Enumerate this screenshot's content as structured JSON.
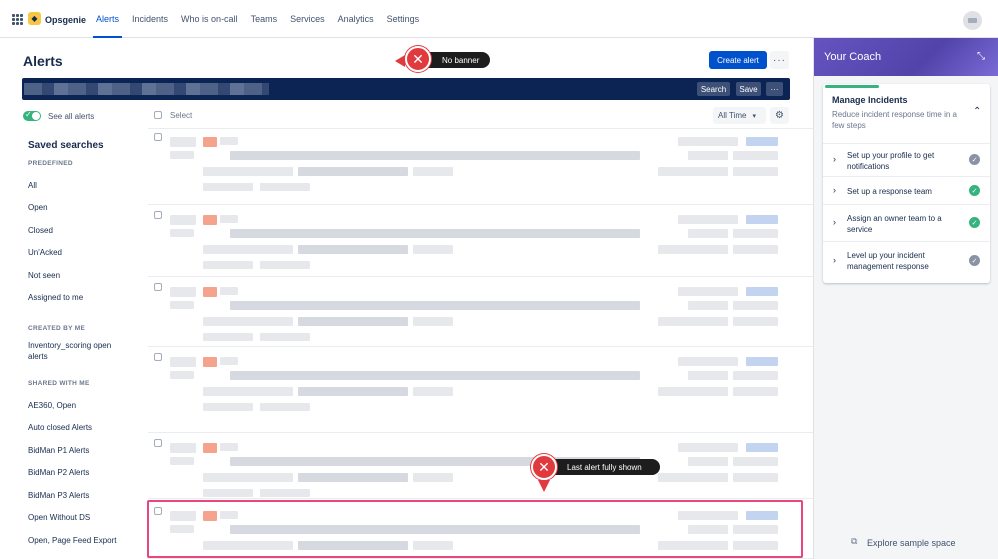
{
  "app": {
    "brand": "Opsgenie"
  },
  "nav": [
    "Alerts",
    "Incidents",
    "Who is on-call",
    "Teams",
    "Services",
    "Analytics",
    "Settings"
  ],
  "page": {
    "title": "Alerts",
    "create_label": "Create alert",
    "more_label": "···"
  },
  "query": {
    "help": "?",
    "search": "Search",
    "save": "Save",
    "more": "···"
  },
  "controls": {
    "see_all": "See all alerts",
    "select": "Select",
    "time_range": "All Time"
  },
  "sidebar": {
    "title": "Saved searches",
    "predefined_heading": "PREDEFINED",
    "predefined": [
      "All",
      "Open",
      "Closed",
      "Un'Acked",
      "Not seen",
      "Assigned to me"
    ],
    "created_heading": "CREATED BY ME",
    "created": [
      "Inventory_scoring open alerts"
    ],
    "shared_heading": "SHARED WITH ME",
    "shared": [
      "AE360, Open",
      "Auto closed Alerts",
      "BidMan P1 Alerts",
      "BidMan P2 Alerts",
      "BidMan P3 Alerts",
      "Open Without DS",
      "Open, Page Feed Export"
    ]
  },
  "annotations": {
    "no_banner": "No banner",
    "last_alert": "Last alert fully shown"
  },
  "coach": {
    "title": "Your Coach",
    "card_title": "Manage Incidents",
    "card_subtitle": "Reduce incident response time in a few steps",
    "progress_fraction": 0.33,
    "steps": [
      {
        "label": "Set up your profile to get notifications",
        "done": false
      },
      {
        "label": "Set up a response team",
        "done": true
      },
      {
        "label": "Assign an owner team to a service",
        "done": true
      },
      {
        "label": "Level up your incident management response",
        "done": false
      }
    ],
    "explore": "Explore sample space"
  },
  "colors": {
    "accent": "#0052cc",
    "done": "#36b37e",
    "pending": "#8993a4",
    "coach": "#6554c0",
    "highlight": "#e8467c",
    "annotation": "#e0393e"
  }
}
